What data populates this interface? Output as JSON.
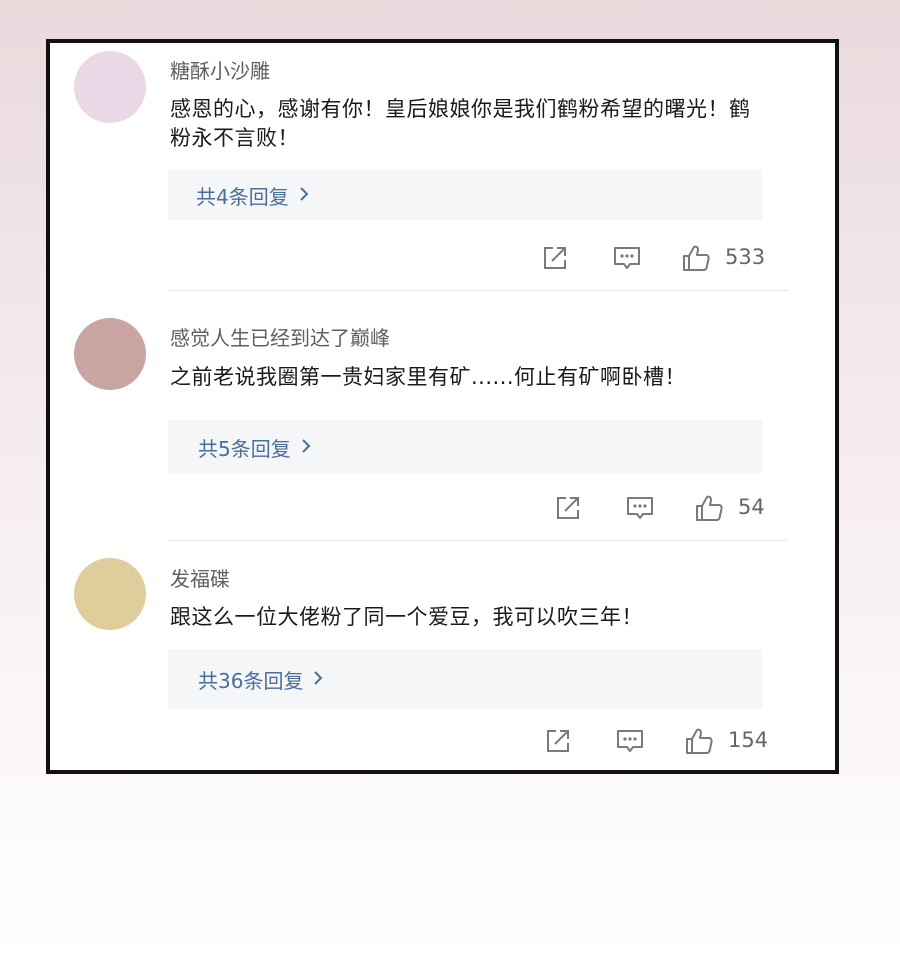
{
  "comments": [
    {
      "username": "糖酥小沙雕",
      "avatar_color": "#ead8e6",
      "text": "感恩的心，感谢有你！皇后娘娘你是我们鹤粉希望的曙光！鹤粉永不言败！",
      "replies_label": "共4条回复",
      "likes": "533"
    },
    {
      "username": "感觉人生已经到达了巅峰",
      "avatar_color": "#c8a5a3",
      "text": "之前老说我圈第一贵妇家里有矿......何止有矿啊卧槽！",
      "replies_label": "共5条回复",
      "likes": "54"
    },
    {
      "username": "发福碟",
      "avatar_color": "#e0cd9c",
      "text": "跟这么一位大佬粉了同一个爱豆，我可以吹三年！",
      "replies_label": "共36条回复",
      "likes": "154"
    }
  ],
  "icons": {
    "share": "share-icon",
    "comment": "comment-icon",
    "like": "thumbs-up-icon",
    "chevron": "chevron-right-icon"
  },
  "colors": {
    "reply_link": "#4a6f9b",
    "card_border": "#111111"
  }
}
